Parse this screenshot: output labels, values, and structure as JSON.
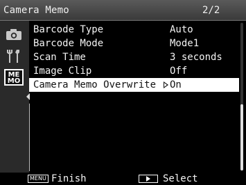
{
  "header": {
    "title": "Camera Memo",
    "page_indicator": "2/2"
  },
  "sidebar": {
    "tabs": [
      {
        "name": "camera",
        "icon": "camera-icon",
        "active": false
      },
      {
        "name": "setup",
        "icon": "wrench-icon",
        "active": false
      },
      {
        "name": "memo",
        "icon": "memo-icon",
        "label": "ME\nMO",
        "active": true
      }
    ]
  },
  "menu": {
    "items": [
      {
        "label": "Barcode Type",
        "value": "Auto"
      },
      {
        "label": "Barcode Mode",
        "value": "Mode1"
      },
      {
        "label": "Scan Time",
        "value": "3 seconds"
      },
      {
        "label": "Image Clip",
        "value": "Off"
      },
      {
        "label": "Camera Memo Overwrite",
        "value": "On",
        "selected": true
      }
    ]
  },
  "scrollbar": {
    "position": "bottom",
    "visible_fraction": 0.45
  },
  "footer": {
    "menu_key": "MENU",
    "finish_label": "Finish",
    "play_key_icon": "play-icon",
    "select_label": "Select"
  },
  "colors": {
    "background": "#000000",
    "selected_row": "#ffffff",
    "text": "#f4f4f4"
  }
}
